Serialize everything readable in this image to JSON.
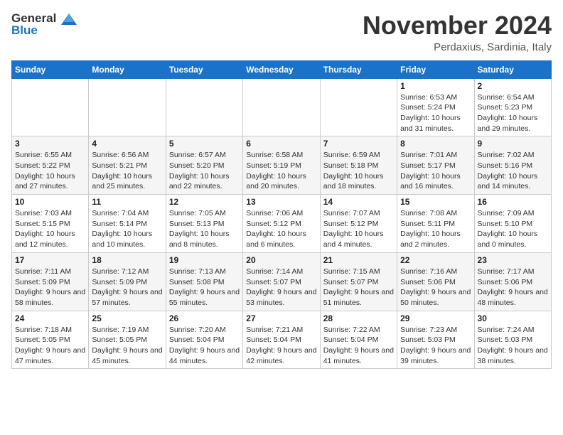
{
  "header": {
    "logo_line1": "General",
    "logo_line2": "Blue",
    "month": "November 2024",
    "location": "Perdaxius, Sardinia, Italy"
  },
  "days_of_week": [
    "Sunday",
    "Monday",
    "Tuesday",
    "Wednesday",
    "Thursday",
    "Friday",
    "Saturday"
  ],
  "weeks": [
    [
      {
        "day": "",
        "detail": ""
      },
      {
        "day": "",
        "detail": ""
      },
      {
        "day": "",
        "detail": ""
      },
      {
        "day": "",
        "detail": ""
      },
      {
        "day": "",
        "detail": ""
      },
      {
        "day": "1",
        "detail": "Sunrise: 6:53 AM\nSunset: 5:24 PM\nDaylight: 10 hours and 31 minutes."
      },
      {
        "day": "2",
        "detail": "Sunrise: 6:54 AM\nSunset: 5:23 PM\nDaylight: 10 hours and 29 minutes."
      }
    ],
    [
      {
        "day": "3",
        "detail": "Sunrise: 6:55 AM\nSunset: 5:22 PM\nDaylight: 10 hours and 27 minutes."
      },
      {
        "day": "4",
        "detail": "Sunrise: 6:56 AM\nSunset: 5:21 PM\nDaylight: 10 hours and 25 minutes."
      },
      {
        "day": "5",
        "detail": "Sunrise: 6:57 AM\nSunset: 5:20 PM\nDaylight: 10 hours and 22 minutes."
      },
      {
        "day": "6",
        "detail": "Sunrise: 6:58 AM\nSunset: 5:19 PM\nDaylight: 10 hours and 20 minutes."
      },
      {
        "day": "7",
        "detail": "Sunrise: 6:59 AM\nSunset: 5:18 PM\nDaylight: 10 hours and 18 minutes."
      },
      {
        "day": "8",
        "detail": "Sunrise: 7:01 AM\nSunset: 5:17 PM\nDaylight: 10 hours and 16 minutes."
      },
      {
        "day": "9",
        "detail": "Sunrise: 7:02 AM\nSunset: 5:16 PM\nDaylight: 10 hours and 14 minutes."
      }
    ],
    [
      {
        "day": "10",
        "detail": "Sunrise: 7:03 AM\nSunset: 5:15 PM\nDaylight: 10 hours and 12 minutes."
      },
      {
        "day": "11",
        "detail": "Sunrise: 7:04 AM\nSunset: 5:14 PM\nDaylight: 10 hours and 10 minutes."
      },
      {
        "day": "12",
        "detail": "Sunrise: 7:05 AM\nSunset: 5:13 PM\nDaylight: 10 hours and 8 minutes."
      },
      {
        "day": "13",
        "detail": "Sunrise: 7:06 AM\nSunset: 5:12 PM\nDaylight: 10 hours and 6 minutes."
      },
      {
        "day": "14",
        "detail": "Sunrise: 7:07 AM\nSunset: 5:12 PM\nDaylight: 10 hours and 4 minutes."
      },
      {
        "day": "15",
        "detail": "Sunrise: 7:08 AM\nSunset: 5:11 PM\nDaylight: 10 hours and 2 minutes."
      },
      {
        "day": "16",
        "detail": "Sunrise: 7:09 AM\nSunset: 5:10 PM\nDaylight: 10 hours and 0 minutes."
      }
    ],
    [
      {
        "day": "17",
        "detail": "Sunrise: 7:11 AM\nSunset: 5:09 PM\nDaylight: 9 hours and 58 minutes."
      },
      {
        "day": "18",
        "detail": "Sunrise: 7:12 AM\nSunset: 5:09 PM\nDaylight: 9 hours and 57 minutes."
      },
      {
        "day": "19",
        "detail": "Sunrise: 7:13 AM\nSunset: 5:08 PM\nDaylight: 9 hours and 55 minutes."
      },
      {
        "day": "20",
        "detail": "Sunrise: 7:14 AM\nSunset: 5:07 PM\nDaylight: 9 hours and 53 minutes."
      },
      {
        "day": "21",
        "detail": "Sunrise: 7:15 AM\nSunset: 5:07 PM\nDaylight: 9 hours and 51 minutes."
      },
      {
        "day": "22",
        "detail": "Sunrise: 7:16 AM\nSunset: 5:06 PM\nDaylight: 9 hours and 50 minutes."
      },
      {
        "day": "23",
        "detail": "Sunrise: 7:17 AM\nSunset: 5:06 PM\nDaylight: 9 hours and 48 minutes."
      }
    ],
    [
      {
        "day": "24",
        "detail": "Sunrise: 7:18 AM\nSunset: 5:05 PM\nDaylight: 9 hours and 47 minutes."
      },
      {
        "day": "25",
        "detail": "Sunrise: 7:19 AM\nSunset: 5:05 PM\nDaylight: 9 hours and 45 minutes."
      },
      {
        "day": "26",
        "detail": "Sunrise: 7:20 AM\nSunset: 5:04 PM\nDaylight: 9 hours and 44 minutes."
      },
      {
        "day": "27",
        "detail": "Sunrise: 7:21 AM\nSunset: 5:04 PM\nDaylight: 9 hours and 42 minutes."
      },
      {
        "day": "28",
        "detail": "Sunrise: 7:22 AM\nSunset: 5:04 PM\nDaylight: 9 hours and 41 minutes."
      },
      {
        "day": "29",
        "detail": "Sunrise: 7:23 AM\nSunset: 5:03 PM\nDaylight: 9 hours and 39 minutes."
      },
      {
        "day": "30",
        "detail": "Sunrise: 7:24 AM\nSunset: 5:03 PM\nDaylight: 9 hours and 38 minutes."
      }
    ]
  ]
}
